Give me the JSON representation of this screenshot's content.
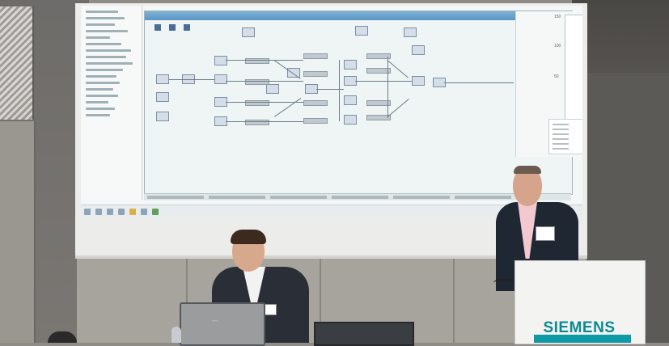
{
  "lectern": {
    "brand": "SIEMENS"
  },
  "colors": {
    "brand_teal": "#0b8a94",
    "trend_bar_green": "#8fdc3f",
    "editor_titlebar_blue": "#5b95c2"
  },
  "trend_panel": {
    "axis_values": [
      "150",
      "100",
      "50"
    ]
  }
}
